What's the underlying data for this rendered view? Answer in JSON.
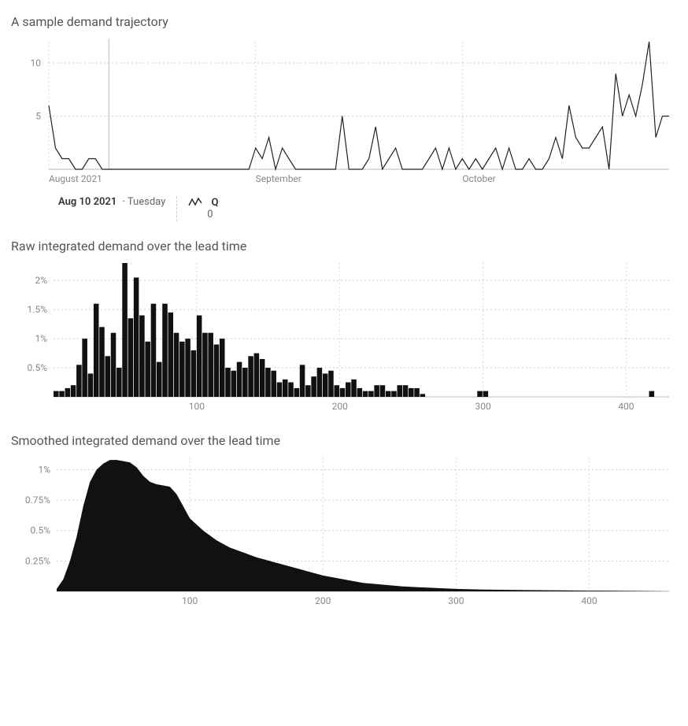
{
  "chart1": {
    "title": "A sample demand trajectory",
    "legend_date": "Aug 10 2021",
    "legend_dow": "Tuesday",
    "series_name": "Q",
    "series_value": "0",
    "x_ticks": [
      "August 2021",
      "September",
      "October"
    ],
    "y_ticks": [
      "5",
      "10"
    ]
  },
  "chart2": {
    "title": "Raw integrated demand over the lead time",
    "x_ticks": [
      "100",
      "200",
      "300",
      "400"
    ],
    "y_ticks": [
      "0.5%",
      "1%",
      "1.5%",
      "2%"
    ]
  },
  "chart3": {
    "title": "Smoothed integrated demand over the lead time",
    "x_ticks": [
      "100",
      "200",
      "300",
      "400"
    ],
    "y_ticks": [
      "0.25%",
      "0.5%",
      "0.75%",
      "1%"
    ]
  },
  "chart_data": [
    {
      "type": "line",
      "title": "A sample demand trajectory",
      "xlabel": "",
      "ylabel": "",
      "ylim": [
        0,
        12
      ],
      "x_start": "2021-08-01",
      "x_end": "2021-10-31",
      "cursor_date": "2021-08-10",
      "y_ticks": [
        5,
        10
      ],
      "x_tick_labels": [
        "August 2021",
        "September",
        "October"
      ],
      "series": [
        {
          "name": "Q",
          "values": [
            6,
            2,
            1,
            1,
            0,
            0,
            1,
            1,
            0,
            0,
            0,
            0,
            0,
            0,
            0,
            0,
            0,
            0,
            0,
            0,
            0,
            0,
            0,
            0,
            0,
            0,
            0,
            0,
            0,
            0,
            0,
            2,
            1,
            3,
            0,
            2,
            1,
            0,
            0,
            0,
            0,
            0,
            0,
            0,
            5,
            0,
            0,
            0,
            1,
            4,
            0,
            1,
            2,
            0,
            0,
            0,
            0,
            1,
            2,
            0,
            2,
            0,
            1,
            0,
            1,
            0,
            1,
            2,
            0,
            2,
            0,
            0,
            1,
            0,
            0,
            1,
            3,
            1,
            6,
            3,
            2,
            2,
            3,
            4,
            0,
            9,
            5,
            7,
            5,
            8,
            12,
            3,
            5,
            5
          ]
        }
      ]
    },
    {
      "type": "bar",
      "title": "Raw integrated demand over the lead time",
      "xlabel": "",
      "ylabel": "",
      "xlim": [
        0,
        430
      ],
      "ylim": [
        0,
        2.3
      ],
      "y_unit": "%",
      "x_ticks": [
        100,
        200,
        300,
        400
      ],
      "y_ticks": [
        0.5,
        1.0,
        1.5,
        2.0
      ],
      "bins_x": [
        0,
        4,
        8,
        12,
        16,
        20,
        24,
        28,
        32,
        36,
        40,
        44,
        48,
        52,
        56,
        60,
        64,
        68,
        72,
        76,
        80,
        84,
        88,
        92,
        96,
        100,
        104,
        108,
        112,
        116,
        120,
        124,
        128,
        132,
        136,
        140,
        144,
        148,
        152,
        156,
        160,
        164,
        168,
        172,
        176,
        180,
        184,
        188,
        192,
        196,
        200,
        204,
        208,
        212,
        216,
        220,
        224,
        228,
        232,
        236,
        240,
        244,
        248,
        252,
        256,
        296,
        300,
        416
      ],
      "bins_pct": [
        0.1,
        0.1,
        0.15,
        0.2,
        0.55,
        1.0,
        0.4,
        1.6,
        1.2,
        0.7,
        1.1,
        0.5,
        2.3,
        1.35,
        2.05,
        1.4,
        0.95,
        1.6,
        0.6,
        1.6,
        1.45,
        1.1,
        0.95,
        1.0,
        0.8,
        1.4,
        1.1,
        1.1,
        0.9,
        1.0,
        0.5,
        0.45,
        0.6,
        0.5,
        0.7,
        0.75,
        0.65,
        0.5,
        0.45,
        0.25,
        0.3,
        0.25,
        0.15,
        0.55,
        0.2,
        0.35,
        0.5,
        0.4,
        0.45,
        0.2,
        0.15,
        0.25,
        0.3,
        0.15,
        0.1,
        0.1,
        0.2,
        0.2,
        0.1,
        0.1,
        0.2,
        0.2,
        0.15,
        0.15,
        0.05,
        0.1,
        0.1,
        0.1
      ]
    },
    {
      "type": "area",
      "title": "Smoothed integrated demand over the lead time",
      "xlabel": "",
      "ylabel": "",
      "xlim": [
        0,
        460
      ],
      "ylim": [
        0,
        1.1
      ],
      "y_unit": "%",
      "x_ticks": [
        100,
        200,
        300,
        400
      ],
      "y_ticks": [
        0.25,
        0.5,
        0.75,
        1.0
      ],
      "x": [
        0,
        5,
        10,
        15,
        20,
        25,
        30,
        35,
        40,
        45,
        50,
        55,
        60,
        65,
        70,
        75,
        80,
        85,
        90,
        95,
        100,
        110,
        120,
        130,
        140,
        150,
        160,
        170,
        180,
        190,
        200,
        210,
        220,
        230,
        240,
        250,
        260,
        270,
        280,
        290,
        300,
        320,
        340,
        360,
        380,
        400,
        420,
        440,
        460
      ],
      "pct": [
        0.02,
        0.1,
        0.25,
        0.45,
        0.7,
        0.9,
        1.0,
        1.05,
        1.08,
        1.08,
        1.07,
        1.06,
        1.02,
        0.95,
        0.9,
        0.88,
        0.87,
        0.86,
        0.8,
        0.7,
        0.6,
        0.5,
        0.42,
        0.36,
        0.32,
        0.28,
        0.25,
        0.22,
        0.19,
        0.16,
        0.13,
        0.11,
        0.09,
        0.07,
        0.06,
        0.05,
        0.04,
        0.035,
        0.03,
        0.025,
        0.02,
        0.015,
        0.012,
        0.01,
        0.008,
        0.006,
        0.005,
        0.003,
        0
      ]
    }
  ]
}
